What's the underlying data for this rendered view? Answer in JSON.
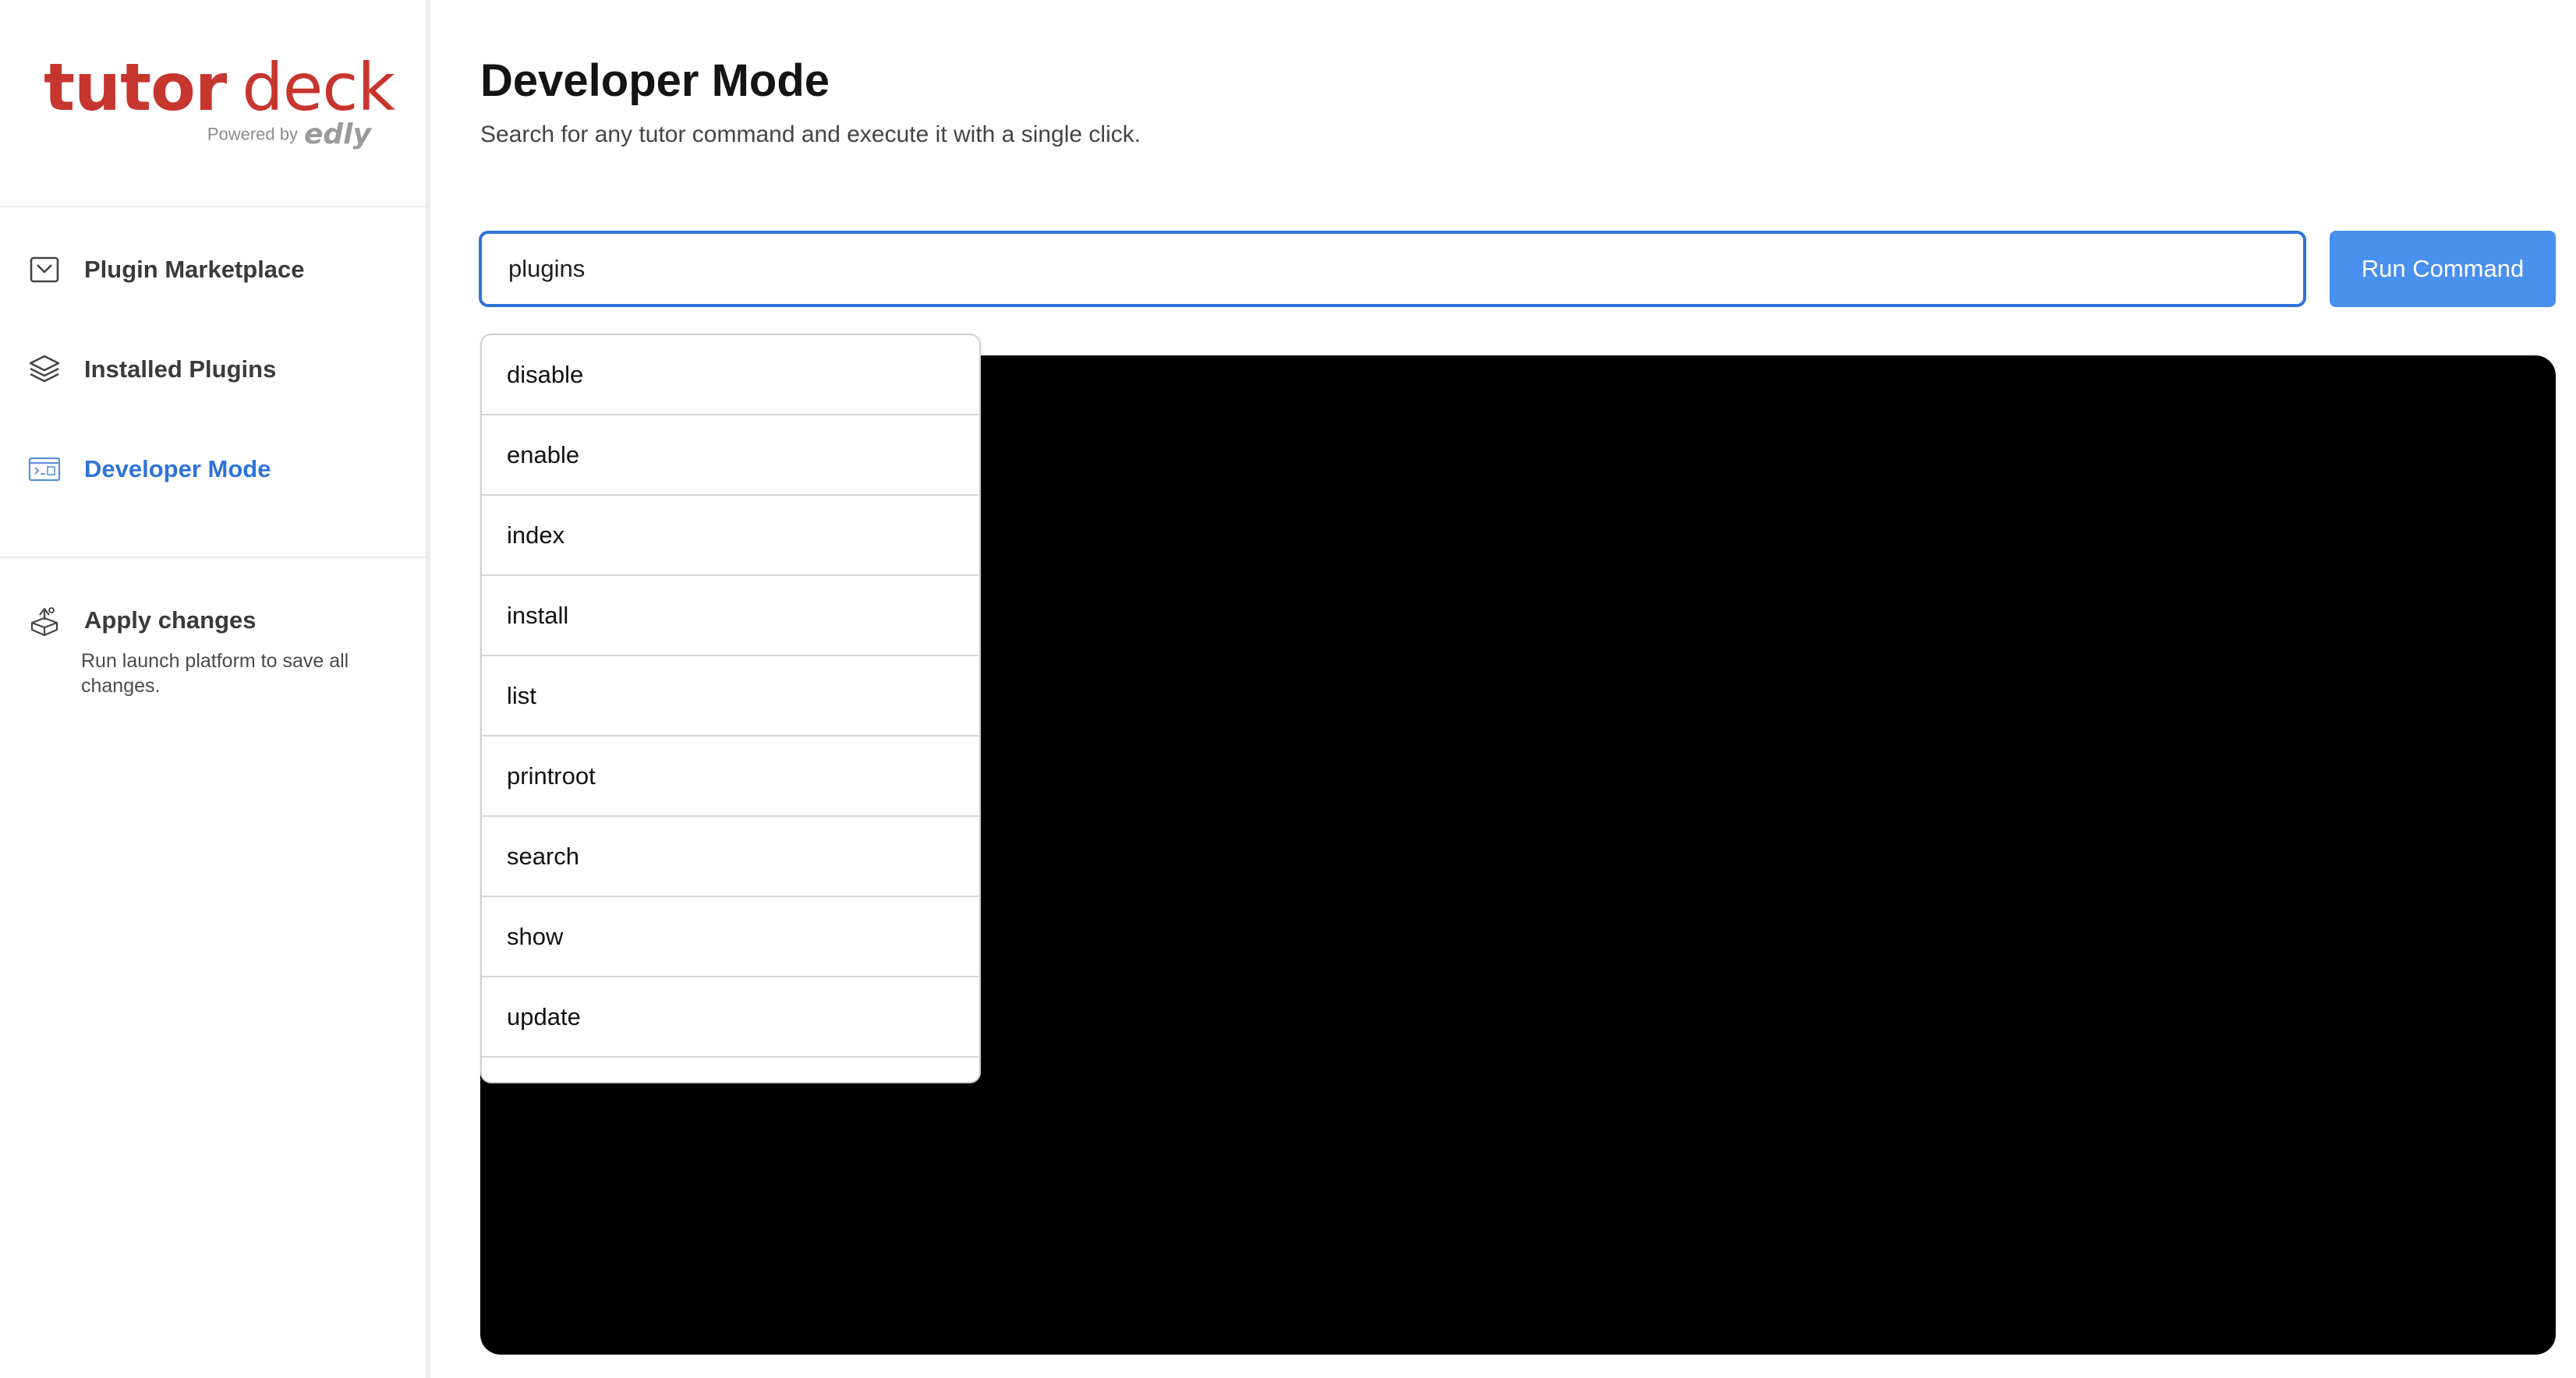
{
  "sidebar": {
    "logo": {
      "primary": "tutor",
      "secondary": "deck",
      "powered_by": "Powered by",
      "brand": "edly"
    },
    "nav": [
      {
        "label": "Plugin Marketplace",
        "icon": "marketplace-icon",
        "active": false
      },
      {
        "label": "Installed Plugins",
        "icon": "layers-icon",
        "active": false
      },
      {
        "label": "Developer Mode",
        "icon": "terminal-icon",
        "active": true
      }
    ],
    "apply": {
      "label": "Apply changes",
      "icon": "deploy-box-icon",
      "description": "Run launch platform to save all changes."
    }
  },
  "main": {
    "title": "Developer Mode",
    "subtitle": "Search for any tutor command and execute it with a single click.",
    "command_input": {
      "value": "plugins",
      "placeholder": ""
    },
    "run_button_label": "Run Command",
    "suggestions": [
      "disable",
      "enable",
      "index",
      "install",
      "list",
      "printroot",
      "search",
      "show",
      "update"
    ]
  },
  "colors": {
    "brand_red": "#c7352f",
    "accent_blue": "#2f73d8",
    "button_blue": "#4a90ee",
    "terminal_bg": "#000000"
  }
}
